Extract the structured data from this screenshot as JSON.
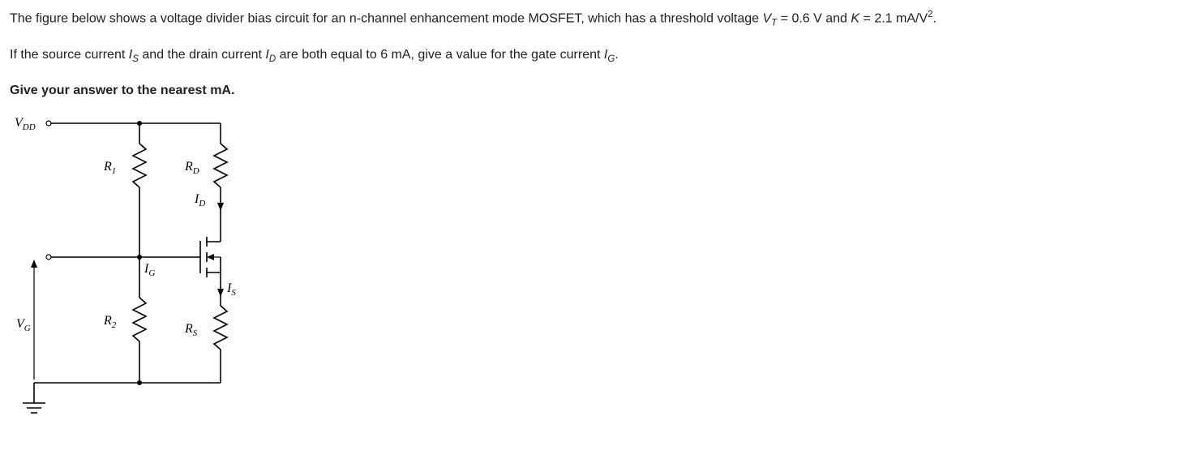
{
  "problem": {
    "p1_a": "The figure below shows a voltage divider bias circuit for an n-channel enhancement mode MOSFET, which has a threshold voltage ",
    "p1_vt_sym": "V",
    "p1_vt_sub": "T",
    "p1_vt_eq": " = 0.6 V and ",
    "p1_k_sym": "K",
    "p1_k_eq": " = 2.1 mA/V",
    "p1_k_exp": "2",
    "p1_end": ".",
    "p2_a": "If the source current ",
    "p2_is_sym": "I",
    "p2_is_sub": "S",
    "p2_b": " and the drain current ",
    "p2_id_sym": "I",
    "p2_id_sub": "D",
    "p2_c": " are both equal to 6 mA, give a value for the gate current ",
    "p2_ig_sym": "I",
    "p2_ig_sub": "G",
    "p2_end": ".",
    "p3": "Give your answer to the nearest mA."
  },
  "circuit": {
    "vdd": "V",
    "vdd_sub": "DD",
    "r1": "R",
    "r1_sub": "1",
    "rd": "R",
    "rd_sub": "D",
    "r2": "R",
    "r2_sub": "2",
    "rs": "R",
    "rs_sub": "S",
    "id": "I",
    "id_sub": "D",
    "ig": "I",
    "ig_sub": "G",
    "is": "I",
    "is_sub": "S",
    "vg": "V",
    "vg_sub": "G"
  }
}
